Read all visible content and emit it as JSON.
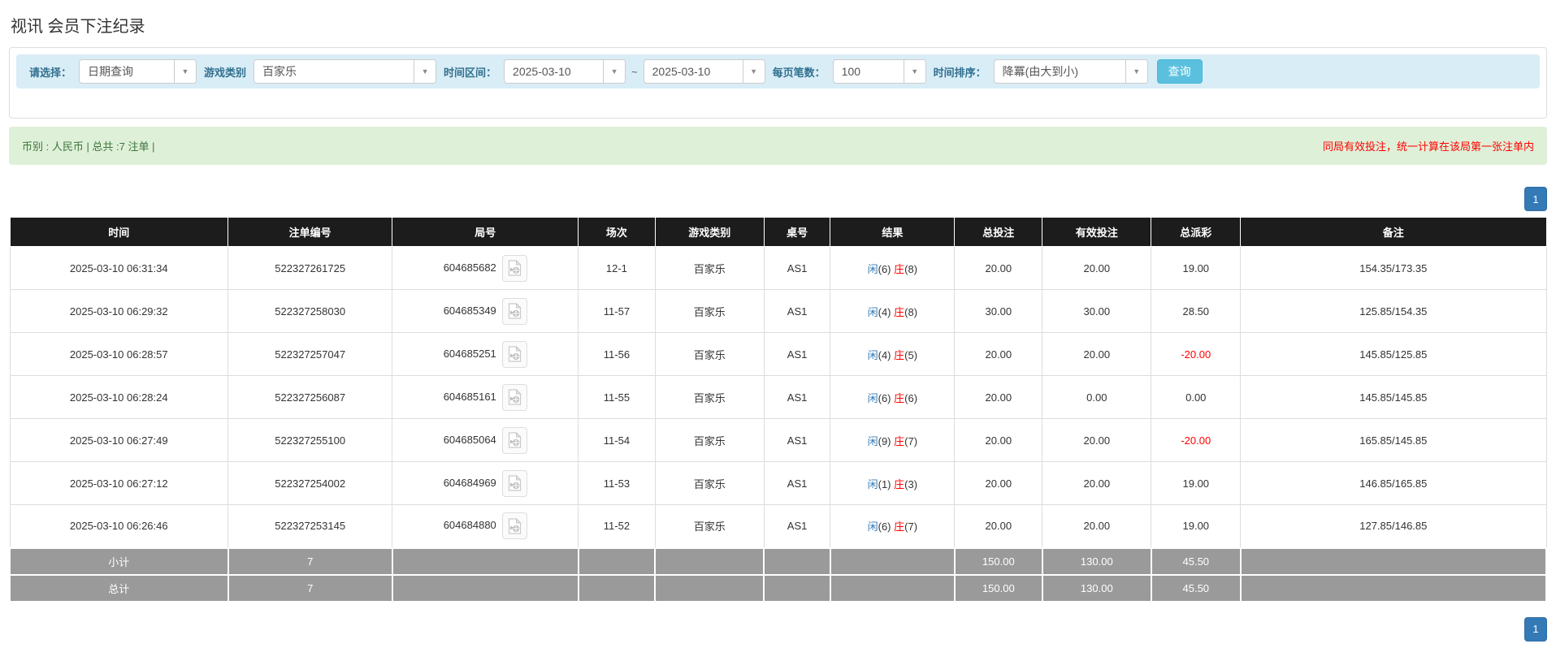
{
  "page": {
    "title": "视讯 会员下注纪录"
  },
  "filters": {
    "select_type": {
      "label": "请选择：",
      "value": "日期查询"
    },
    "game_category": {
      "label": "游戏类别",
      "value": "百家乐"
    },
    "date_range": {
      "label": "时间区间：",
      "from": "2025-03-10",
      "separator": "~",
      "to": "2025-03-10"
    },
    "page_size": {
      "label": "每页笔数：",
      "value": "100"
    },
    "time_sort": {
      "label": "时间排序：",
      "value": "降冪(由大到小)"
    },
    "search_button": "查询"
  },
  "summary_bar": {
    "left_text": "币别 : 人民币 | 总共 :7 注单 |",
    "right_text": "同局有效投注，统一计算在该局第一张注单内"
  },
  "pagination": {
    "page": "1"
  },
  "table": {
    "headers": [
      "时间",
      "注单编号",
      "局号",
      "场次",
      "游戏类别",
      "桌号",
      "结果",
      "总投注",
      "有效投注",
      "总派彩",
      "备注"
    ],
    "rows": [
      {
        "time": "2025-03-10 06:31:34",
        "bet_id": "522327261725",
        "round_id": "604685682",
        "session": "12-1",
        "game": "百家乐",
        "table_no": "AS1",
        "player_label": "闲",
        "player_score": "(6)",
        "banker_label": "庄",
        "banker_score": "(8)",
        "total_bet": "20.00",
        "valid_bet": "20.00",
        "payout": "19.00",
        "remark": "154.35/173.35"
      },
      {
        "time": "2025-03-10 06:29:32",
        "bet_id": "522327258030",
        "round_id": "604685349",
        "session": "11-57",
        "game": "百家乐",
        "table_no": "AS1",
        "player_label": "闲",
        "player_score": "(4)",
        "banker_label": "庄",
        "banker_score": "(8)",
        "total_bet": "30.00",
        "valid_bet": "30.00",
        "payout": "28.50",
        "remark": "125.85/154.35"
      },
      {
        "time": "2025-03-10 06:28:57",
        "bet_id": "522327257047",
        "round_id": "604685251",
        "session": "11-56",
        "game": "百家乐",
        "table_no": "AS1",
        "player_label": "闲",
        "player_score": "(4)",
        "banker_label": "庄",
        "banker_score": "(5)",
        "total_bet": "20.00",
        "valid_bet": "20.00",
        "payout": "-20.00",
        "remark": "145.85/125.85"
      },
      {
        "time": "2025-03-10 06:28:24",
        "bet_id": "522327256087",
        "round_id": "604685161",
        "session": "11-55",
        "game": "百家乐",
        "table_no": "AS1",
        "player_label": "闲",
        "player_score": "(6)",
        "banker_label": "庄",
        "banker_score": "(6)",
        "total_bet": "20.00",
        "valid_bet": "0.00",
        "payout": "0.00",
        "remark": "145.85/145.85"
      },
      {
        "time": "2025-03-10 06:27:49",
        "bet_id": "522327255100",
        "round_id": "604685064",
        "session": "11-54",
        "game": "百家乐",
        "table_no": "AS1",
        "player_label": "闲",
        "player_score": "(9)",
        "banker_label": "庄",
        "banker_score": "(7)",
        "total_bet": "20.00",
        "valid_bet": "20.00",
        "payout": "-20.00",
        "remark": "165.85/145.85"
      },
      {
        "time": "2025-03-10 06:27:12",
        "bet_id": "522327254002",
        "round_id": "604684969",
        "session": "11-53",
        "game": "百家乐",
        "table_no": "AS1",
        "player_label": "闲",
        "player_score": "(1)",
        "banker_label": "庄",
        "banker_score": "(3)",
        "total_bet": "20.00",
        "valid_bet": "20.00",
        "payout": "19.00",
        "remark": "146.85/165.85"
      },
      {
        "time": "2025-03-10 06:26:46",
        "bet_id": "522327253145",
        "round_id": "604684880",
        "session": "11-52",
        "game": "百家乐",
        "table_no": "AS1",
        "player_label": "闲",
        "player_score": "(6)",
        "banker_label": "庄",
        "banker_score": "(7)",
        "total_bet": "20.00",
        "valid_bet": "20.00",
        "payout": "19.00",
        "remark": "127.85/146.85"
      }
    ],
    "subtotal": {
      "label": "小计",
      "count": "7",
      "total_bet": "150.00",
      "valid_bet": "130.00",
      "payout": "45.50"
    },
    "total": {
      "label": "总计",
      "count": "7",
      "total_bet": "150.00",
      "valid_bet": "130.00",
      "payout": "45.50"
    }
  },
  "colors": {
    "accent_blue": "#337ab7",
    "label_blue": "#31708f",
    "search_button_bg": "#5bc0de",
    "negative_red": "#ff0000",
    "banker_red": "#ff0000",
    "player_blue": "#337ab7",
    "summary_green_bg": "#dff0d8",
    "summary_green_text": "#3c763d",
    "filter_bar_bg": "#d9edf7",
    "table_header_bg": "#1c1c1c",
    "subtotal_bg": "#9a9a9a"
  }
}
